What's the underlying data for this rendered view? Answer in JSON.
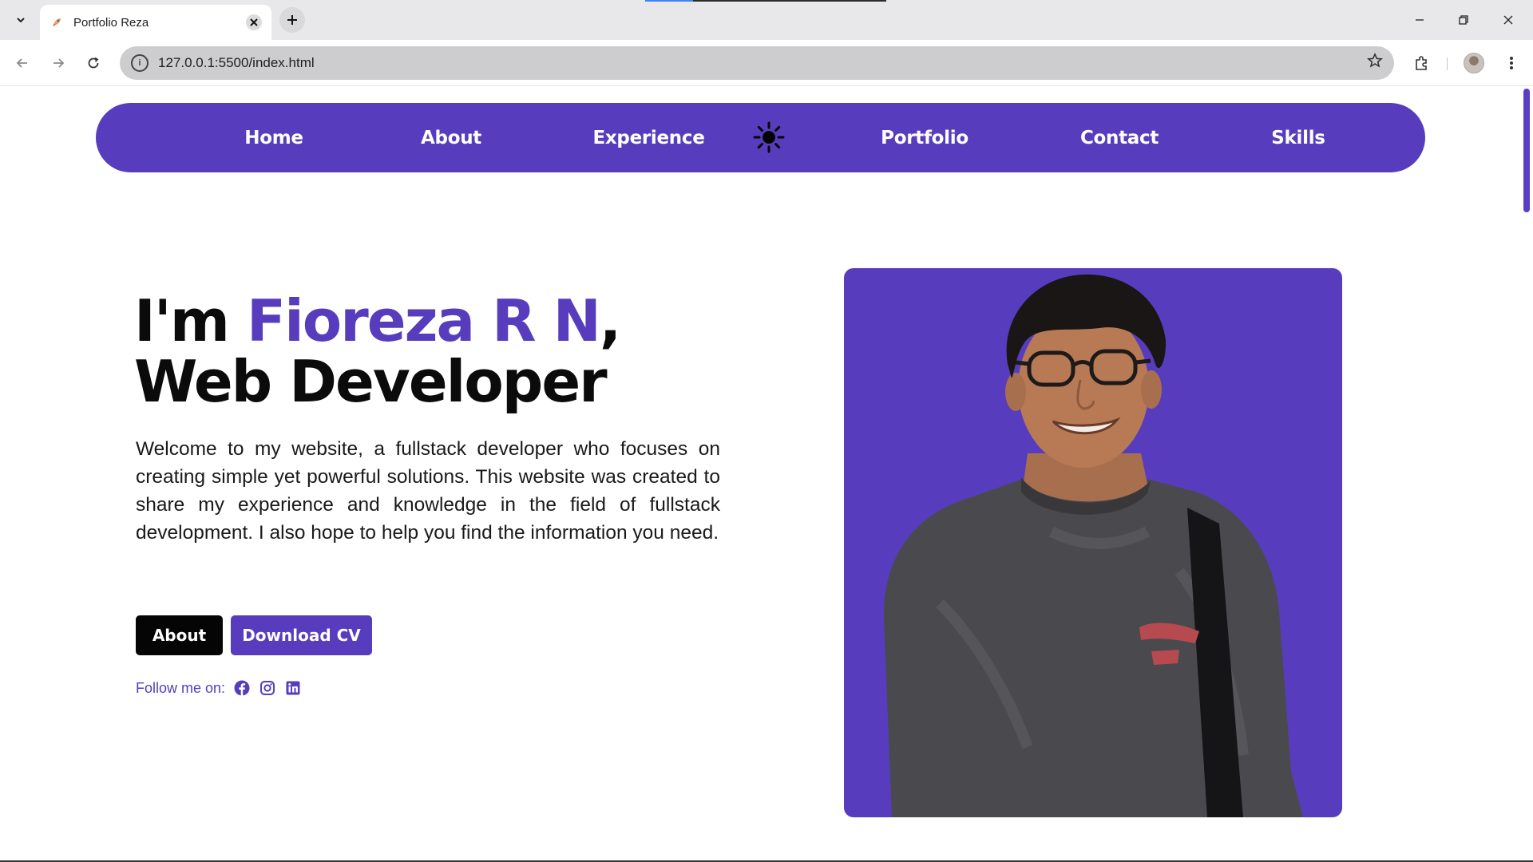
{
  "browser": {
    "tab_title": "Portfolio Reza",
    "url": "127.0.0.1:5500/index.html",
    "icons": {
      "tab_list": "chevron-down-icon",
      "favicon": "rocket-icon",
      "tab_close": "close-icon",
      "new_tab": "plus-icon",
      "minimize": "minimize-icon",
      "restore": "restore-icon",
      "close_window": "close-icon",
      "back": "arrow-left-icon",
      "forward": "arrow-right-icon",
      "reload": "reload-icon",
      "site_info": "info-icon",
      "bookmark": "star-icon",
      "extensions": "puzzle-icon",
      "menu": "kebab-menu-icon"
    }
  },
  "page": {
    "nav": {
      "items": [
        "Home",
        "About",
        "Experience",
        "Portfolio",
        "Contact",
        "Skills"
      ],
      "theme_icon": "sun-icon"
    },
    "hero": {
      "title_prefix": "I'm ",
      "title_name": "Fioreza R N",
      "title_comma": ",",
      "title_role": "Web Developer",
      "description": "Welcome to my website, a fullstack developer who focuses on creating simple yet powerful solutions. This website was created to share my experience and knowledge in the field of fullstack development. I also hope to help you find the information you need.",
      "buttons": {
        "about": "About",
        "download_cv": "Download CV"
      },
      "follow_label": "Follow me on:",
      "social_icons": [
        "facebook-icon",
        "instagram-icon",
        "linkedin-icon"
      ]
    },
    "colors": {
      "accent": "#573dbd",
      "dark_button": "#050505",
      "text": "#0b0b0b"
    }
  }
}
